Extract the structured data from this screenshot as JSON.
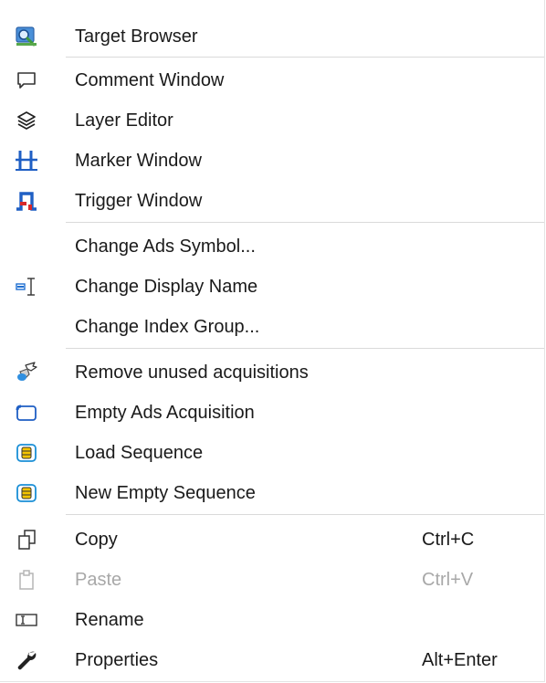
{
  "menu": {
    "items": [
      {
        "label": "Target Browser",
        "icon": "target-browser-icon"
      },
      {
        "label": "Comment Window",
        "icon": "comment-icon"
      },
      {
        "label": "Layer Editor",
        "icon": "layers-icon"
      },
      {
        "label": "Marker Window",
        "icon": "marker-icon"
      },
      {
        "label": "Trigger Window",
        "icon": "trigger-icon"
      },
      {
        "label": "Change Ads Symbol..."
      },
      {
        "label": "Change Display Name",
        "icon": "text-cursor-icon"
      },
      {
        "label": "Change Index Group..."
      },
      {
        "label": "Remove unused acquisitions",
        "icon": "broom-icon"
      },
      {
        "label": "Empty Ads Acquisition",
        "icon": "acquisition-icon"
      },
      {
        "label": "Load Sequence",
        "icon": "sequence-icon"
      },
      {
        "label": "New Empty Sequence",
        "icon": "sequence-icon"
      },
      {
        "label": "Copy",
        "shortcut": "Ctrl+C",
        "icon": "copy-icon"
      },
      {
        "label": "Paste",
        "shortcut": "Ctrl+V",
        "icon": "paste-icon",
        "disabled": true
      },
      {
        "label": "Rename",
        "icon": "rename-icon"
      },
      {
        "label": "Properties",
        "shortcut": "Alt+Enter",
        "icon": "wrench-icon"
      }
    ]
  },
  "colors": {
    "text": "#1a1a1a",
    "disabled_text": "#a8a8a8",
    "separator": "#dadada",
    "icon_blue": "#1f6fd1",
    "icon_red": "#d8282a",
    "icon_yellow": "#f5c400"
  }
}
